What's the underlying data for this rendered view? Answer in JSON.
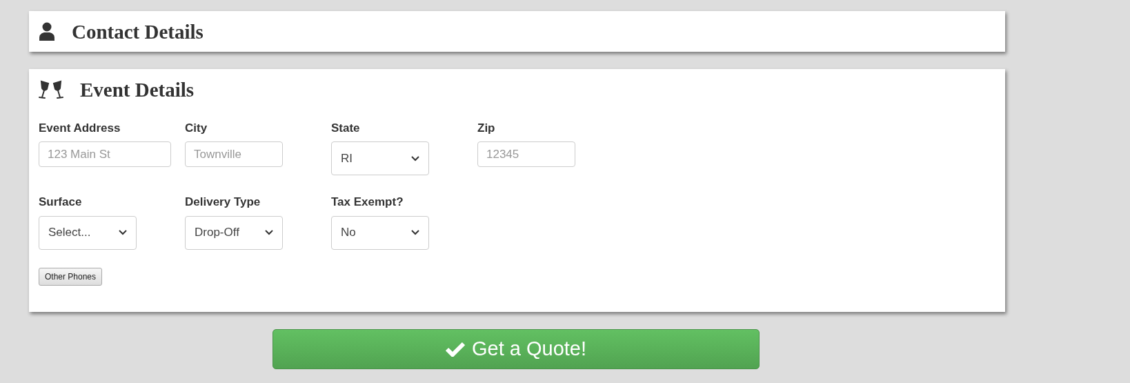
{
  "sections": [
    {
      "title": "Contact Details"
    },
    {
      "title": "Event Details",
      "rows": [
        [
          {
            "kind": "text",
            "label": "Event Address",
            "placeholder": "123 Main St"
          },
          {
            "kind": "text",
            "label": "City",
            "placeholder": "Townville"
          },
          {
            "kind": "select",
            "label": "State",
            "value": "RI"
          },
          {
            "kind": "text",
            "label": "Zip",
            "placeholder": "12345"
          }
        ],
        [
          {
            "kind": "select",
            "label": "Surface",
            "value": "Select..."
          },
          {
            "kind": "select",
            "label": "Delivery Type",
            "value": "Drop-Off"
          },
          {
            "kind": "select",
            "label": "Tax Exempt?",
            "value": "No"
          }
        ]
      ],
      "button": "Other Phones"
    }
  ],
  "submit": "Get a Quote!"
}
